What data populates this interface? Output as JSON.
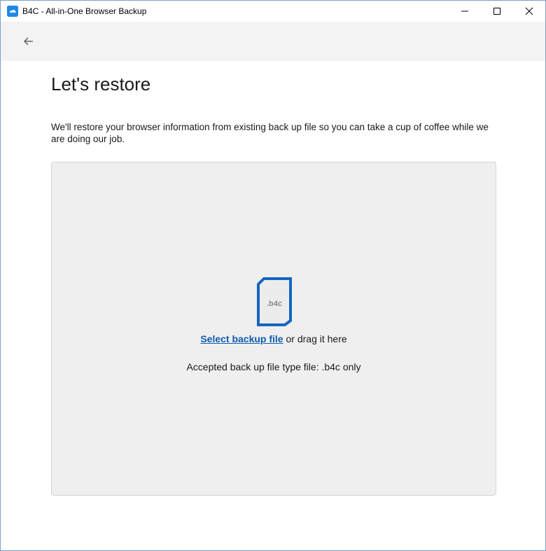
{
  "window": {
    "title": "B4C - All-in-One Browser Backup",
    "icon": "app-logo-icon",
    "controls": {
      "minimize_icon": "minimize-icon",
      "maximize_icon": "maximize-icon",
      "close_icon": "close-icon"
    }
  },
  "header": {
    "back_icon": "back-arrow-icon"
  },
  "main": {
    "heading": "Let's restore",
    "description": "We'll restore your browser information from existing back up file so you can take a cup of coffee while we are doing our job.",
    "dropzone": {
      "file_icon_label": ".b4c",
      "select_link": "Select backup file",
      "drag_text": " or drag it here",
      "accepted_text": "Accepted back up file type file: .b4c only"
    }
  },
  "colors": {
    "accent": "#1565c0",
    "link": "#0f5cad",
    "dropzone_bg": "#efefef",
    "header_bg": "#f3f3f3"
  }
}
